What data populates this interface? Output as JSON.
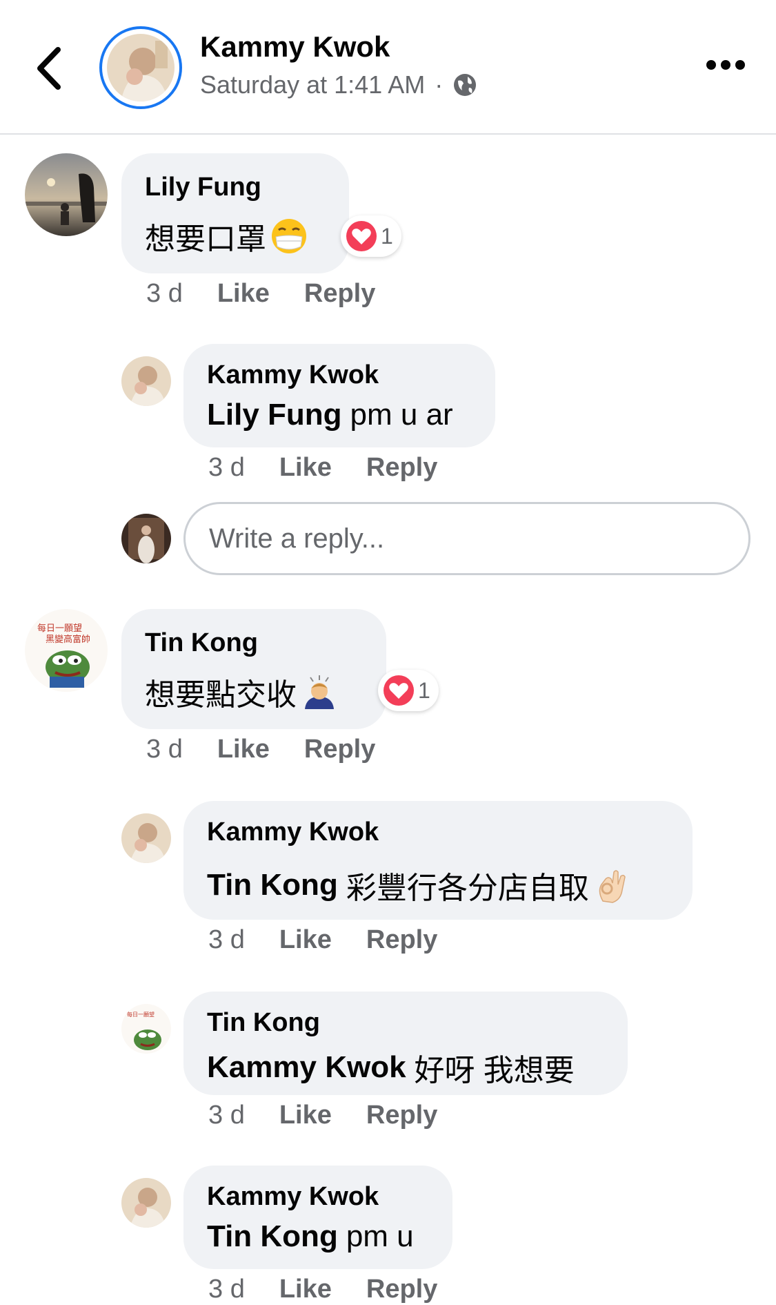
{
  "header": {
    "name": "Kammy Kwok",
    "time": "Saturday at 1:41 AM",
    "separator": "·"
  },
  "comments": [
    {
      "author": "Lily Fung",
      "text": "想要口罩",
      "mention": "",
      "time": "3 d",
      "like": "Like",
      "reply": "Reply",
      "reaction_count": "1"
    },
    {
      "author": "Kammy Kwok",
      "mention": "Lily Fung",
      "text": "pm u ar",
      "time": "3 d",
      "like": "Like",
      "reply": "Reply"
    },
    {
      "author": "Tin Kong",
      "text": "想要點交收",
      "mention": "",
      "time": "3 d",
      "like": "Like",
      "reply": "Reply",
      "reaction_count": "1"
    },
    {
      "author": "Kammy Kwok",
      "mention": "Tin Kong",
      "text": "彩豐行各分店自取",
      "time": "3 d",
      "like": "Like",
      "reply": "Reply"
    },
    {
      "author": "Tin Kong",
      "mention": "Kammy Kwok",
      "text": "好呀 我想要",
      "time": "3 d",
      "like": "Like",
      "reply": "Reply"
    },
    {
      "author": "Kammy Kwok",
      "mention": "Tin Kong",
      "text": "pm u",
      "time": "3 d",
      "like": "Like",
      "reply": "Reply"
    }
  ],
  "reply_box": {
    "placeholder": "Write a reply..."
  },
  "colors": {
    "accent": "#1877f2",
    "bubble": "#f0f2f5",
    "muted": "#65676b",
    "heart": "#f33e58"
  },
  "icons": [
    "back-icon",
    "globe-icon",
    "more-icon",
    "heart-reaction-icon",
    "mask-emoji",
    "bowing-person-emoji",
    "ok-hand-emoji"
  ]
}
